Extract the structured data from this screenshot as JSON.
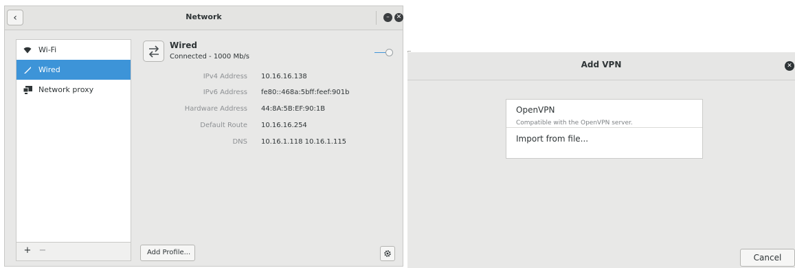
{
  "network_window": {
    "title": "Network",
    "back_icon": "chevron-left-icon",
    "minimize_icon": "minimize-icon",
    "close_icon": "close-icon",
    "sidebar": {
      "items": [
        {
          "label": "Wi-Fi",
          "icon": "wifi-icon",
          "active": false
        },
        {
          "label": "Wired",
          "icon": "wired-icon",
          "active": true
        },
        {
          "label": "Network proxy",
          "icon": "network-proxy-icon",
          "active": false
        }
      ],
      "add_label": "+",
      "remove_label": "−"
    },
    "connection": {
      "name": "Wired",
      "status": "Connected - 1000 Mb/s",
      "toggle_on": true,
      "properties": [
        {
          "label": "IPv4 Address",
          "value": "10.16.16.138"
        },
        {
          "label": "IPv6 Address",
          "value": "fe80::468a:5bff:feef:901b"
        },
        {
          "label": "Hardware Address",
          "value": "44:8A:5B:EF:90:1B"
        },
        {
          "label": "Default Route",
          "value": "10.16.16.254"
        },
        {
          "label": "DNS",
          "value": "10.16.1.118 10.16.1.115"
        }
      ]
    },
    "add_profile_label": "Add Profile...",
    "settings_icon": "gear-icon",
    "accent_color": "#3d94d8"
  },
  "vpn_dialog": {
    "title": "Add VPN",
    "close_icon": "close-icon",
    "options": [
      {
        "name": "OpenVPN",
        "description": "Compatible with the OpenVPN server."
      },
      {
        "name": "Import from file..."
      }
    ],
    "cancel_label": "Cancel"
  }
}
